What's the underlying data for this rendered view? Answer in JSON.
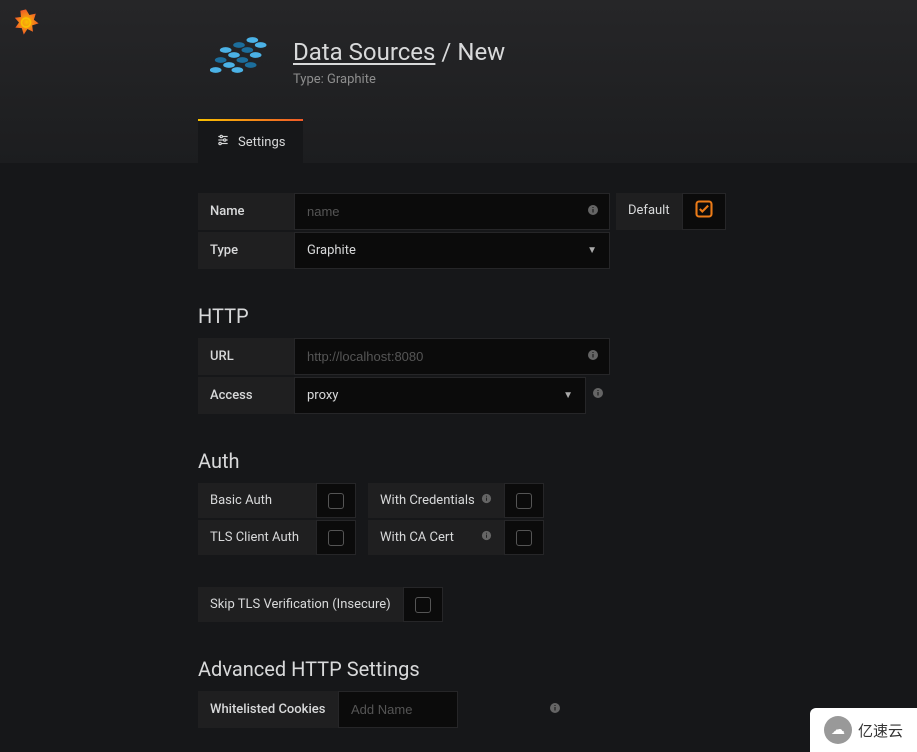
{
  "header": {
    "breadcrumb_link": "Data Sources",
    "breadcrumb_sep": " / ",
    "breadcrumb_current": "New",
    "subtext": "Type: Graphite"
  },
  "tabs": {
    "settings": "Settings"
  },
  "form": {
    "name_label": "Name",
    "name_placeholder": "name",
    "type_label": "Type",
    "type_value": "Graphite",
    "default_label": "Default"
  },
  "http": {
    "title": "HTTP",
    "url_label": "URL",
    "url_placeholder": "http://localhost:8080",
    "access_label": "Access",
    "access_value": "proxy"
  },
  "auth": {
    "title": "Auth",
    "basic": "Basic Auth",
    "withcred": "With Credentials",
    "tls": "TLS Client Auth",
    "cacert": "With CA Cert",
    "skip": "Skip TLS Verification (Insecure)"
  },
  "advanced": {
    "title": "Advanced HTTP Settings",
    "whitelisted": "Whitelisted Cookies",
    "addname_placeholder": "Add Name"
  },
  "watermark": "亿速云"
}
